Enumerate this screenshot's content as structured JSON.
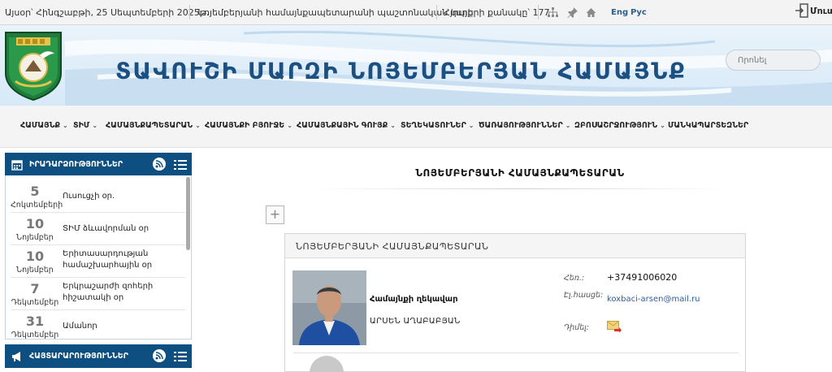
{
  "topbar": {
    "date": "Այսօր՝ Հինգշաբթի, 25 Սեպտեմբերի 2025թ.",
    "site_caption": "Նոյեմբերյանի համայնքապետարանի պաշտոնական կայք",
    "visitors": "Հյուրերի քանակը՝ 177",
    "icons": [
      "sitemap-icon",
      "pin-icon",
      "home-icon"
    ],
    "lang_en": "Eng",
    "lang_ru": "Рус",
    "login_label": "Մուտք"
  },
  "banner": {
    "title": "ՏԱՎՈՒՇԻ ՄԱՐԶԻ ՆՈՅԵՄԲԵՐՅԱՆ ՀԱՄԱՅՆՔ",
    "search_placeholder": "Որոնել"
  },
  "nav": {
    "items": [
      "ՀԱՄԱՅՆՔ",
      "ՏԻՄ",
      "ՀԱՄԱՅՆՔԱՊԵՏԱՐԱՆ",
      "ՀԱՄԱՅՆՔԻ ԲՅՈՒՋԵ",
      "ՀԱՄԱՅՆՔԱՅԻՆ ԳՈՒՅՔ",
      "ՏԵՂԵԿԱՏՈՒՆԵՐ",
      "ԾԱՌԱՅՈՒԹՅՈՒՆՆԵՐ",
      "ԶԲՈՍԱՇՐՋՈՒԹՅՈՒՆ",
      "ՄԱՆԿԱՊԱՐՏԵԶՆԵՐ"
    ]
  },
  "sidebar": {
    "events_title": "ԻՐԱԴԱՐՁՈՒԹՅՈՒՆՆԵՐ",
    "events": [
      {
        "day": "5",
        "month": "Հոկտեմբերի",
        "title": "Ուսուցչի օր."
      },
      {
        "day": "10",
        "month": "Նոյեմբեր",
        "title": "ՏԻՄ ձևավորման օր"
      },
      {
        "day": "10",
        "month": "Նոյեմբեր",
        "title": "Երիտասարդության համաշխարհային օր"
      },
      {
        "day": "7",
        "month": "Դեկտեմբեր",
        "title": "Երկրաշարժի զոհերի հիշատակի օր"
      },
      {
        "day": "31",
        "month": "Դեկտեմբեր",
        "title": "Ամանոր"
      }
    ],
    "announcements_title": "ՀԱՅՏԱՐԱՐՈՒԹՅՈՒՆՆԵՐ"
  },
  "main": {
    "title": "ՆՈՅԵՄԲԵՐՅԱՆԻ ՀԱՄԱՅՆՔԱՊԵՏԱՐԱՆ",
    "expand_symbol": "+",
    "card": {
      "header": "ՆՈՅԵՄԲԵՐՅԱՆԻ ՀԱՄԱՅՆՔԱՊԵՏԱՐԱՆ",
      "role": "Համայնքի ղեկավար",
      "name": "ԱՐՍԵՆ ԱՂԱԲԱԲՅԱՆ",
      "phone_label": "Հեռ.:",
      "phone": "+37491006020",
      "email_label": "Էլ.հասցե:",
      "email": "koxbaci-arsen@mail.ru",
      "appeal_label": "Դիմել:"
    }
  },
  "colors": {
    "brand_blue": "#0e4f82",
    "title_blue": "#1c4f82",
    "link_blue": "#2a5f9e"
  }
}
